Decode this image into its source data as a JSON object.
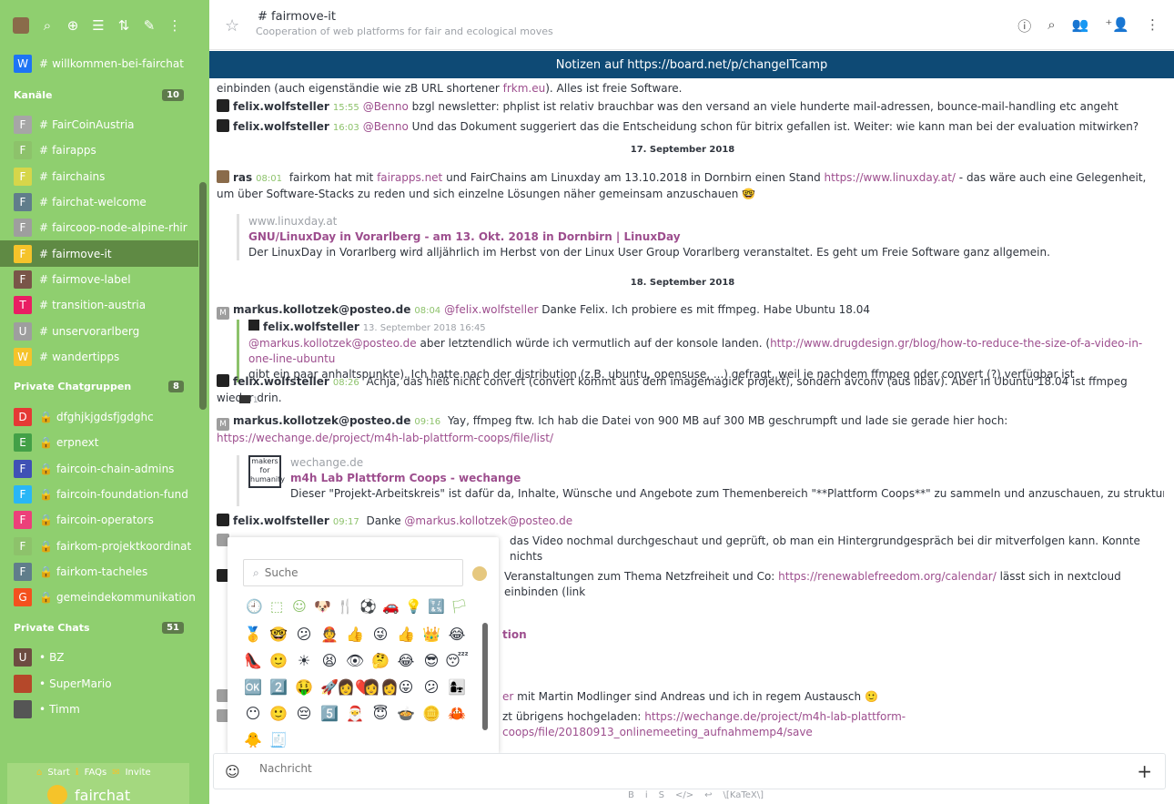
{
  "sidebar": {
    "pinned": {
      "letter": "W",
      "color": "#1d74f5",
      "name": "willkommen-bei-fairchat"
    },
    "sections": [
      {
        "title": "Kanäle",
        "count": "10"
      },
      {
        "title": "Private Chatgruppen",
        "count": "8"
      },
      {
        "title": "Private Chats",
        "count": "51"
      }
    ],
    "channels": [
      {
        "letter": "F",
        "color": "#a6a6a6",
        "name": "FairCoinAustria"
      },
      {
        "letter": "F",
        "color": "#8dc26b",
        "name": "fairapps"
      },
      {
        "letter": "F",
        "color": "#d6d64a",
        "name": "fairchains"
      },
      {
        "letter": "F",
        "color": "#607d8b",
        "name": "fairchat-welcome"
      },
      {
        "letter": "F",
        "color": "#9e9e9e",
        "name": "faircoop-node-alpine-rhir"
      },
      {
        "letter": "F",
        "color": "#f5c32a",
        "name": "fairmove-it"
      },
      {
        "letter": "F",
        "color": "#795548",
        "name": "fairmove-label"
      },
      {
        "letter": "T",
        "color": "#e91e63",
        "name": "transition-austria"
      },
      {
        "letter": "U",
        "color": "#9e9e9e",
        "name": "unservorarlberg"
      },
      {
        "letter": "W",
        "color": "#f5c32a",
        "name": "wandertipps"
      }
    ],
    "groups": [
      {
        "letter": "D",
        "color": "#e53935",
        "name": "dfghjkjgdsfjgdghc"
      },
      {
        "letter": "E",
        "color": "#43a047",
        "name": "erpnext"
      },
      {
        "letter": "F",
        "color": "#3f51b5",
        "name": "faircoin-chain-admins"
      },
      {
        "letter": "F",
        "color": "#29b6f6",
        "name": "faircoin-foundation-fund"
      },
      {
        "letter": "F",
        "color": "#ec407a",
        "name": "faircoin-operators"
      },
      {
        "letter": "F",
        "color": "#8dc26b",
        "name": "fairkom-projektkoordinat"
      },
      {
        "letter": "F",
        "color": "#607d8b",
        "name": "fairkom-tacheles"
      },
      {
        "letter": "G",
        "color": "#f4511e",
        "name": "gemeindekommunikation"
      }
    ],
    "chats": [
      {
        "letter": "U",
        "color": "#6d4c41",
        "name": "BZ"
      },
      {
        "letter": "",
        "color": "#b5482a",
        "name": "SuperMario"
      },
      {
        "letter": "",
        "color": "#555555",
        "name": "Timm"
      }
    ],
    "footer": {
      "start": "Start",
      "faqs": "FAQs",
      "invite": "Invite",
      "brand": "fairchat"
    }
  },
  "header": {
    "room_name": "# fairmove-it",
    "topic": "Cooperation of web platforms for fair and ecological moves",
    "announcement": "Notizen auf https://board.net/p/changeITcamp"
  },
  "messages": {
    "m0": {
      "text": "einbinden (auch eigenständie wie zB URL shortener ",
      "link": "frkm.eu",
      "tail": "). Alles ist freie Software."
    },
    "m1": {
      "user": "felix.wolfsteller",
      "time": "15:55",
      "mention": "@Benno",
      "text": " bzgl newsletter: phplist ist relativ brauchbar was den versand an viele hunderte mail-adressen, bounce-mail-handling etc angeht"
    },
    "m2": {
      "user": "felix.wolfsteller",
      "time": "16:03",
      "mention": "@Benno",
      "text": " Und das Dokument suggeriert das die Entscheidung schon für bitrix gefallen ist. Weiter: wie kann man bei der evaluation mitwirken?"
    },
    "date1": "17. September 2018",
    "m3": {
      "user": "ras",
      "time": "08:01",
      "text1": " fairkom hat mit ",
      "link1": "fairapps.net",
      "text2": " und FairChains am Linuxday am 13.10.2018 in Dornbirn einen Stand ",
      "link2": "https://www.linuxday.at/",
      "text3": " - das wäre auch eine Gelegenheit, um über Software-Stacks zu reden und sich einzelne Lösungen näher gemeinsam anzuschauen 🤓"
    },
    "q1": {
      "host": "www.linuxday.at",
      "title": "GNU/LinuxDay in Vorarlberg - am 13. Okt. 2018 in Dornbirn | LinuxDay",
      "desc": "Der LinuxDay in Vorarlberg wird alljährlich im Herbst von der Linux User Group Vorarlberg veranstaltet. Es geht um Freie Software ganz allgemein."
    },
    "date2": "18. September 2018",
    "m4": {
      "user": "markus.kollotzek@posteo.de",
      "time": "08:04",
      "mention": "@felix.wolfsteller",
      "text": " Danke Felix. Ich probiere es mit ffmpeg. Habe Ubuntu 18.04"
    },
    "q2": {
      "user": "felix.wolfsteller",
      "date": "13. September 2018 16:45",
      "mention": "@markus.kollotzek@posteo.de",
      "text1": " aber letztendlich würde ich vermutlich auf der konsole landen. (",
      "link": "http://www.drugdesign.gr/blog/how-to-reduce-the-size-of-a-video-in-one-line-ubuntu",
      "text2": "gibt ein paar anhaltspunkte). Ich hatte nach der distribution (z.B. ubuntu, opensuse, ...) gefragt, weil je nachdem ffmpeg oder convert (?) verfügbar ist"
    },
    "m5": {
      "user": "felix.wolfsteller",
      "time": "08:26",
      "text": " Achja, das hieß nicht convert (convert kommt aus dem imagemagick projekt), sondern avconv (aus libav). Aber in Ubuntu 18.04 ist ffmpeg wieder drin.",
      "reaction": "1"
    },
    "m6": {
      "user": "markus.kollotzek@posteo.de",
      "time": "09:16",
      "text": " Yay, ffmpeg ftw. Ich hab die Datei von 900 MB auf 300 MB geschrumpft und lade sie gerade hier hoch: ",
      "link": "https://wechange.de/project/m4h-lab-plattform-coops/file/list/"
    },
    "q3": {
      "logo": "makers for humanity",
      "host": "wechange.de",
      "title": "m4h Lab Plattform Coops - wechange",
      "desc": "Dieser \"Projekt-Arbeitskreis\" ist dafür da, Inhalte, Wünsche und Angebote zum Themenbereich \"**Plattform Coops**\" zu sammeln und anzuschauen, zu strukturieren und zu …"
    },
    "m7": {
      "user": "felix.wolfsteller",
      "time": "09:17",
      "text": " Danke ",
      "mention": "@markus.kollotzek@posteo.de"
    },
    "m8": {
      "text": " das Video nochmal durchgeschaut und geprüft, ob man ein Hintergrundgespräch bei dir mitverfolgen kann. Konnte nichts"
    },
    "m9": {
      "text": "Veranstaltungen zum Thema Netzfreiheit und Co: ",
      "link": "https://renewablefreedom.org/calendar/",
      "tail": " lässt sich in nextcloud einbinden (link"
    },
    "m10": {
      "text": "tion"
    },
    "m11": {
      "link": "er",
      "text": " mit Martin Modlinger sind Andreas und ich in regem Austausch 🙂"
    },
    "m12": {
      "text": "zt übrigens hochgeladen: ",
      "link": "https://wechange.de/project/m4h-lab-plattform-coops/file/20180913_onlinemeeting_aufnahmemp4/save"
    }
  },
  "emoji_picker": {
    "search_placeholder": "Suche",
    "categories": [
      "🕘",
      "⬚",
      "☺",
      "🐶",
      "🍴",
      "⚽",
      "🚗",
      "💡",
      "🔣",
      "🏳"
    ],
    "emojis": [
      "🥇",
      "🤓",
      "😕",
      "👲",
      "👍",
      "😜",
      "👍",
      "👑",
      "😂",
      "👠",
      "🙂",
      "☀",
      "😫",
      "👁",
      "🤔",
      "😂",
      "😎",
      "😴",
      "🆗",
      "2️⃣",
      "🤑",
      "🚀",
      "👩‍❤",
      "👩‍👩",
      "😛",
      "😕",
      "👩‍👧",
      "😶",
      "🙂",
      "😔",
      "5️⃣",
      "🎅",
      "😇",
      "🍲",
      "🪙",
      "🦀",
      "🐥",
      "🧾"
    ]
  },
  "composer": {
    "placeholder": "Nachricht",
    "format": [
      "B",
      "i",
      "S",
      "</>",
      "↩",
      "\\[KaTeX\\]"
    ]
  }
}
